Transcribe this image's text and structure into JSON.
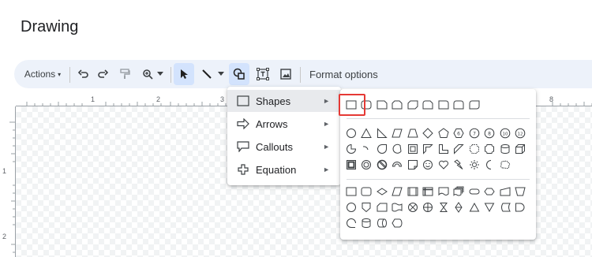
{
  "dialog": {
    "title": "Drawing"
  },
  "toolbar": {
    "actions_label": "Actions",
    "caret": "▾",
    "format_options_label": "Format options",
    "icons": [
      "undo-icon",
      "redo-icon",
      "paint-format-icon",
      "zoom-icon",
      "select-icon",
      "line-icon",
      "shape-icon",
      "text-box-icon",
      "image-icon"
    ]
  },
  "ruler": {
    "top_numbers": [
      "1",
      "2",
      "3",
      "8"
    ],
    "left_numbers": [
      "1",
      "2"
    ]
  },
  "shape_menu": {
    "items": [
      {
        "label": "Shapes",
        "icon": "rectangle-icon",
        "arrow": "►",
        "active": true
      },
      {
        "label": "Arrows",
        "icon": "arrow-right-icon",
        "arrow": "►",
        "active": false
      },
      {
        "label": "Callouts",
        "icon": "callout-icon",
        "arrow": "►",
        "active": false
      },
      {
        "label": "Equation",
        "icon": "plus-icon",
        "arrow": "►",
        "active": false
      }
    ]
  },
  "shapes_panel": {
    "rows": [
      {
        "group": "rectangles",
        "count": 9
      },
      {
        "group": "basic-shapes-1",
        "count": 12,
        "numbers": [
          "6",
          "7",
          "8",
          "10",
          "12"
        ]
      },
      {
        "group": "basic-shapes-2",
        "count": 12
      },
      {
        "group": "basic-shapes-3",
        "count": 12
      },
      {
        "group": "flowchart-1",
        "count": 12
      },
      {
        "group": "flowchart-2",
        "count": 12
      },
      {
        "group": "flowchart-3",
        "count": 4
      }
    ],
    "highlighted_shape": "rectangle",
    "highlight_color": "#e53935"
  },
  "colors": {
    "toolbar_bg": "#edf2fa",
    "selected_tool_bg": "#d3e3fd",
    "active_menu_bg": "#e8eaed"
  }
}
